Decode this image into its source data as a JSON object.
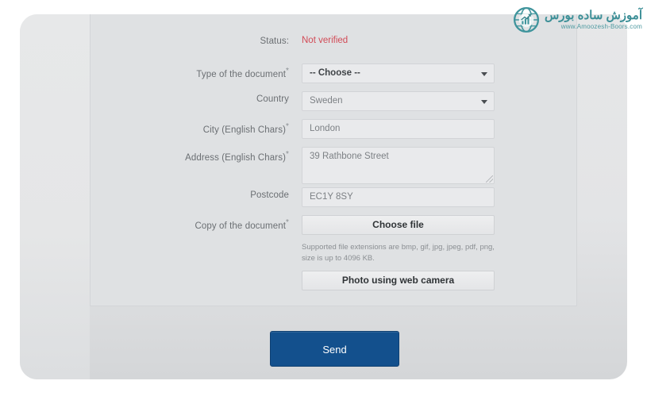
{
  "form": {
    "status_row": {
      "label": "Status:",
      "value": "Not verified",
      "value_color": "#d24b57"
    },
    "fields": [
      {
        "label": "Type of the document",
        "required": true,
        "control": "select",
        "value": "-- Choose --",
        "emphasis": true
      },
      {
        "label": "Country",
        "required": false,
        "control": "select",
        "value": "Sweden",
        "emphasis": false
      },
      {
        "label": "City (English Chars)",
        "required": true,
        "control": "text",
        "value": "London"
      },
      {
        "label": "Address (English Chars)",
        "required": true,
        "control": "textarea",
        "value": "39 Rathbone Street"
      },
      {
        "label": "Postcode",
        "required": false,
        "control": "text",
        "value": "EC1Y 8SY"
      },
      {
        "label": "Copy of the document",
        "required": true,
        "control": "file-button",
        "value": "Choose file"
      }
    ],
    "help_text": "Supported file extensions are bmp, gif, jpg, jpeg, pdf, png, size is up to 4096 KB.",
    "webcam_button": "Photo using web camera",
    "submit_button": "Send",
    "required_marker": "*"
  },
  "watermark": {
    "title": "آموزش ساده بورس",
    "url": "www.Amoozesh-Boors.com",
    "brand_color": "#3c8f97",
    "icon": "globe-chart-icon"
  }
}
